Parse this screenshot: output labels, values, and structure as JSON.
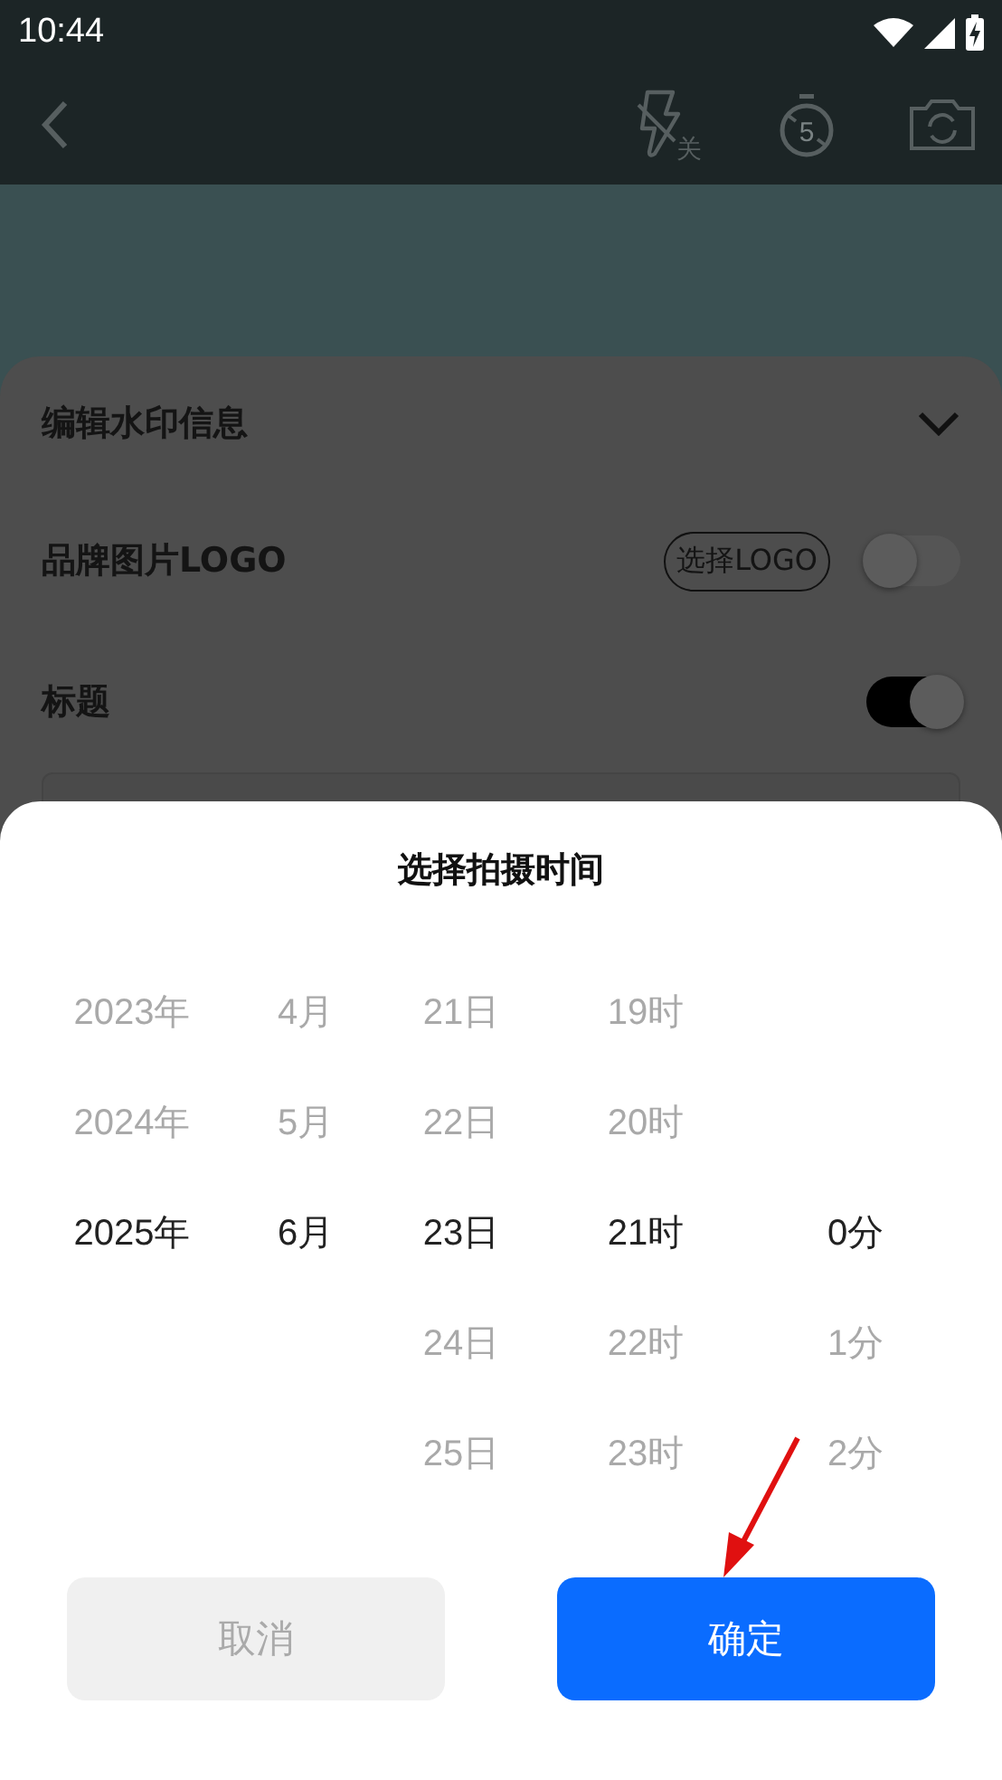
{
  "status_bar": {
    "time": "10:44"
  },
  "camera_toolbar": {
    "flash_label": "关",
    "timer_label": "5"
  },
  "watermark_sheet": {
    "title": "编辑水印信息",
    "rows": [
      {
        "kind": "logo",
        "label": "品牌图片LOGO",
        "button": "选择LOGO",
        "on": false
      },
      {
        "kind": "title",
        "label": "标题",
        "on": true
      }
    ]
  },
  "time_picker": {
    "title": "选择拍摄时间",
    "columns": [
      {
        "items": [
          {
            "label": "2023年",
            "selected": false
          },
          {
            "label": "2024年",
            "selected": false
          },
          {
            "label": "2025年",
            "selected": true
          }
        ]
      },
      {
        "items": [
          {
            "label": "4月",
            "selected": false
          },
          {
            "label": "5月",
            "selected": false
          },
          {
            "label": "6月",
            "selected": true
          }
        ]
      },
      {
        "items": [
          {
            "label": "21日",
            "selected": false
          },
          {
            "label": "22日",
            "selected": false
          },
          {
            "label": "23日",
            "selected": true
          },
          {
            "label": "24日",
            "selected": false
          },
          {
            "label": "25日",
            "selected": false
          }
        ]
      },
      {
        "items": [
          {
            "label": "19时",
            "selected": false
          },
          {
            "label": "20时",
            "selected": false
          },
          {
            "label": "21时",
            "selected": true
          },
          {
            "label": "22时",
            "selected": false
          },
          {
            "label": "23时",
            "selected": false
          }
        ]
      },
      {
        "items": [
          {
            "label": "0分",
            "selected": true
          },
          {
            "label": "1分",
            "selected": false
          },
          {
            "label": "2分",
            "selected": false
          }
        ]
      }
    ],
    "buttons": [
      {
        "kind": "cancel",
        "label": "取消"
      },
      {
        "kind": "confirm",
        "label": "确定"
      }
    ]
  }
}
